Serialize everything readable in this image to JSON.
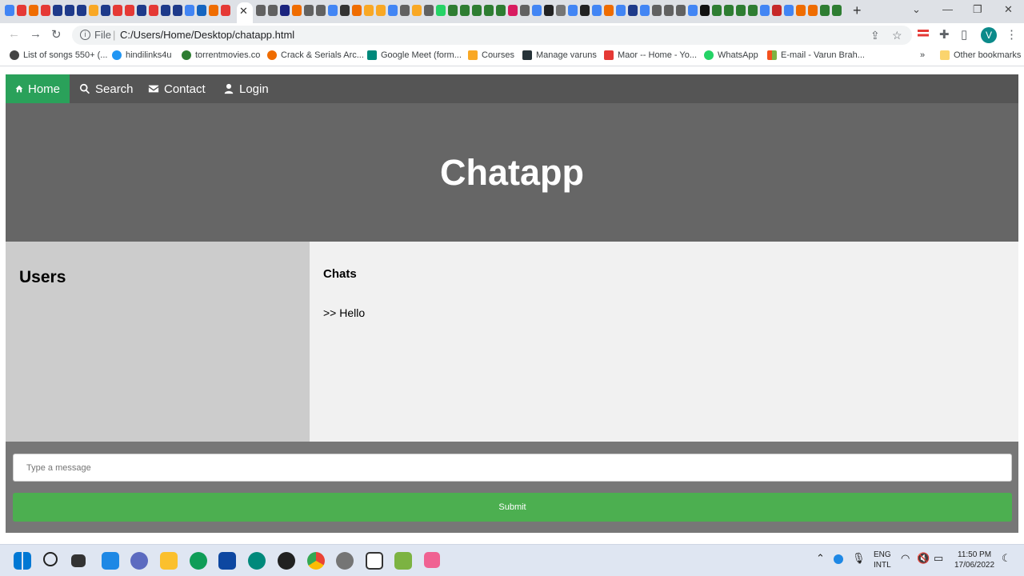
{
  "browser": {
    "url_scheme": "File",
    "url": "C:/Users/Home/Desktop/chatapp.html",
    "avatar_letter": "V",
    "bookmarks": [
      {
        "label": "List of songs 550+ (...",
        "color": "#444444"
      },
      {
        "label": "hindilinks4u",
        "color": "#2196f3"
      },
      {
        "label": "torrentmovies.co",
        "color": "#2e7d32"
      },
      {
        "label": "Crack & Serials Arc...",
        "color": "#ef6c00"
      },
      {
        "label": "Google Meet (form...",
        "color": "#00897b"
      },
      {
        "label": "Courses",
        "color": "#f9a825"
      },
      {
        "label": "Manage varuns",
        "color": "#263238"
      },
      {
        "label": "Maor -- Home - Yo...",
        "color": "#e53935"
      },
      {
        "label": "WhatsApp",
        "color": "#25d366"
      },
      {
        "label": "E-mail - Varun Brah...",
        "color": "#f4511e"
      }
    ],
    "bookmarks_more": "»",
    "other_bookmarks": "Other bookmarks"
  },
  "nav": {
    "home": "Home",
    "search": "Search",
    "contact": "Contact",
    "login": "Login"
  },
  "hero": {
    "title": "Chatapp"
  },
  "users": {
    "heading": "Users"
  },
  "chats": {
    "heading": "Chats",
    "messages": [
      ">> Hello"
    ]
  },
  "composer": {
    "placeholder": "Type a message",
    "submit_label": "Submit"
  },
  "taskbar": {
    "lang": "ENG",
    "layout": "INTL",
    "time": "11:50 PM",
    "date": "17/06/2022"
  },
  "colors": {
    "nav_bg": "#555555",
    "nav_active": "#2aa15a",
    "hero_bg": "#666666",
    "users_bg": "#cccccc",
    "chats_bg": "#f1f1f1",
    "footer_bg": "#777777",
    "submit_bg": "#4caf50"
  }
}
